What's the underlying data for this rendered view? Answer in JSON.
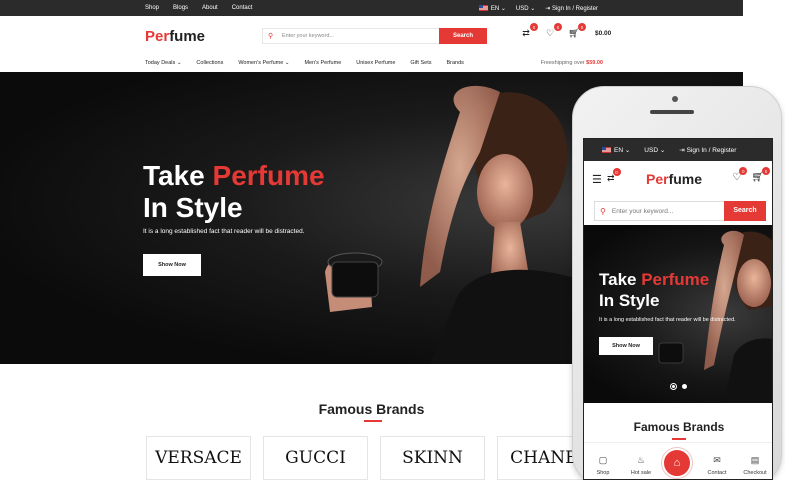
{
  "topbar": {
    "links": [
      "Shop",
      "Blogs",
      "About",
      "Contact"
    ],
    "language": "EN",
    "currency": "USD",
    "account": "Sign In / Register"
  },
  "header": {
    "logo_red": "Per",
    "logo_rest": "fume",
    "search_placeholder": "Enter your keyword...",
    "search_button": "Search",
    "compare_count": "0",
    "wishlist_count": "0",
    "cart_count": "0",
    "cart_total": "$0.00"
  },
  "nav": {
    "items": [
      "Today Deals",
      "Collections",
      "Women's Perfume",
      "Men's Perfume",
      "Unisex Perfume",
      "Gift Sets",
      "Brands"
    ],
    "shipping_text": "Freeshipping over ",
    "shipping_amount": "$59.00"
  },
  "hero": {
    "title_1": "Take ",
    "title_red": "Perfume",
    "title_2": "In Style",
    "subtitle": "It is a long established fact that reader will be distracted.",
    "button": "Show Now"
  },
  "brands": {
    "title": "Famous Brands",
    "items": [
      "VERSACE",
      "GUCCI",
      "SKINN",
      "CHANEL"
    ]
  },
  "mobile": {
    "language": "EN",
    "currency": "USD",
    "account": "Sign In / Register",
    "logo_red": "Per",
    "logo_rest": "fume",
    "search_placeholder": "Enter your keyword...",
    "search_button": "Search",
    "compare_count": "0",
    "wishlist_count": "0",
    "cart_count": "0",
    "hero_title_1": "Take ",
    "hero_title_red": "Perfume",
    "hero_title_2": "In Style",
    "hero_subtitle": "It is a long established fact that reader will be distracted.",
    "hero_button": "Show Now",
    "brands_title": "Famous Brands",
    "tabs": [
      "Shop",
      "Hot sale",
      "Contact",
      "Checkout"
    ]
  },
  "colors": {
    "accent": "#e53935",
    "dark": "#2b2b2b"
  }
}
